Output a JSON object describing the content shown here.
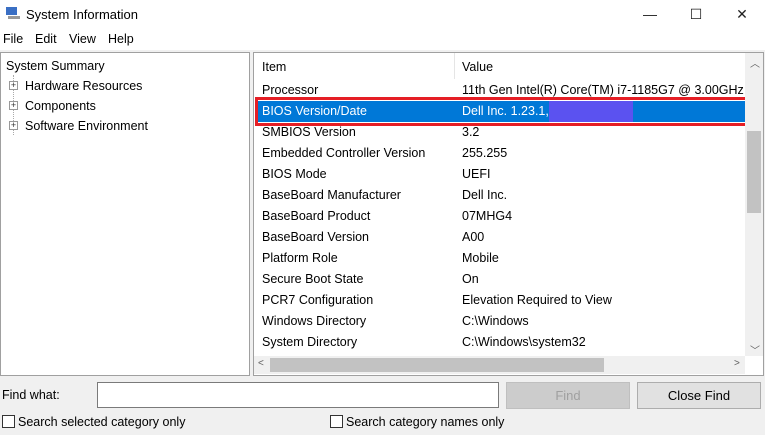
{
  "window": {
    "title": "System Information",
    "minimize": "—",
    "maximize": "☐",
    "close": "✕"
  },
  "menu": [
    "File",
    "Edit",
    "View",
    "Help"
  ],
  "tree": {
    "root": "System Summary",
    "children": [
      "Hardware Resources",
      "Components",
      "Software Environment"
    ]
  },
  "table": {
    "headers": {
      "item": "Item",
      "value": "Value"
    },
    "rows": [
      {
        "item": "Processor",
        "value": "11th Gen Intel(R) Core(TM) i7-1185G7 @ 3.00GHz"
      },
      {
        "item": "BIOS Version/Date",
        "value": "Dell Inc. 1.23.1,"
      },
      {
        "item": "SMBIOS Version",
        "value": "3.2"
      },
      {
        "item": "Embedded Controller Version",
        "value": "255.255"
      },
      {
        "item": "BIOS Mode",
        "value": "UEFI"
      },
      {
        "item": "BaseBoard Manufacturer",
        "value": "Dell Inc."
      },
      {
        "item": "BaseBoard Product",
        "value": "07MHG4"
      },
      {
        "item": "BaseBoard Version",
        "value": "A00"
      },
      {
        "item": "Platform Role",
        "value": "Mobile"
      },
      {
        "item": "Secure Boot State",
        "value": "On"
      },
      {
        "item": "PCR7 Configuration",
        "value": "Elevation Required to View"
      },
      {
        "item": "Windows Directory",
        "value": "C:\\Windows"
      },
      {
        "item": "System Directory",
        "value": "C:\\Windows\\system32"
      }
    ]
  },
  "find": {
    "label": "Find what:",
    "value": "",
    "find_button": "Find",
    "close_button": "Close Find",
    "checkbox_selected": "Search selected category only",
    "checkbox_names": "Search category names only"
  },
  "colors": {
    "selection": "#0078d7",
    "highlight_border": "#e51e25"
  }
}
